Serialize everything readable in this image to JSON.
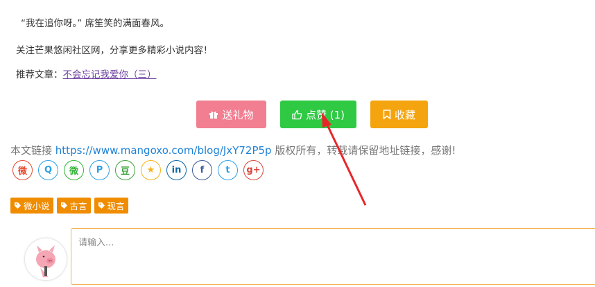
{
  "paragraphs": {
    "line1": "“我在追你呀。” 席笙笑的满面春风。",
    "line2": "关注芒果悠闲社区网，分享更多精彩小说内容！",
    "recommend_label": "推荐文章：",
    "recommend_link": "不会忘记我爱你（三）"
  },
  "actions": {
    "gift_label": "送礼物",
    "like_label": "点赞 (1)",
    "favorite_label": "收藏"
  },
  "link_line": {
    "prefix": "本文链接 ",
    "url": "https://www.mangoxo.com/blog/JxY72P5p",
    "suffix": " 版权所有，转载请保留地址链接，感谢!"
  },
  "share": [
    {
      "name": "weibo-icon",
      "glyph": "微",
      "color": "#e6492f"
    },
    {
      "name": "qq-icon",
      "glyph": "Q",
      "color": "#2ea0e6"
    },
    {
      "name": "wechat-icon",
      "glyph": "微",
      "color": "#32b539"
    },
    {
      "name": "pinterest-icon",
      "glyph": "P",
      "color": "#2ea0e6"
    },
    {
      "name": "douban-icon",
      "glyph": "豆",
      "color": "#3ca33c"
    },
    {
      "name": "qzone-icon",
      "glyph": "★",
      "color": "#f3b21b"
    },
    {
      "name": "linkedin-icon",
      "glyph": "in",
      "color": "#0a66a8"
    },
    {
      "name": "facebook-icon",
      "glyph": "f",
      "color": "#3b5998"
    },
    {
      "name": "twitter-icon",
      "glyph": "t",
      "color": "#2ea0e6"
    },
    {
      "name": "google-plus-icon",
      "glyph": "g+",
      "color": "#d9453b"
    }
  ],
  "tags": [
    "微小说",
    "古言",
    "现言"
  ],
  "comment": {
    "placeholder": "请输入..."
  },
  "colors": {
    "gift": "#f27e91",
    "like": "#2fc944",
    "favorite": "#f4a40e",
    "tag": "#f08c00",
    "arrow": "#e8262a"
  }
}
